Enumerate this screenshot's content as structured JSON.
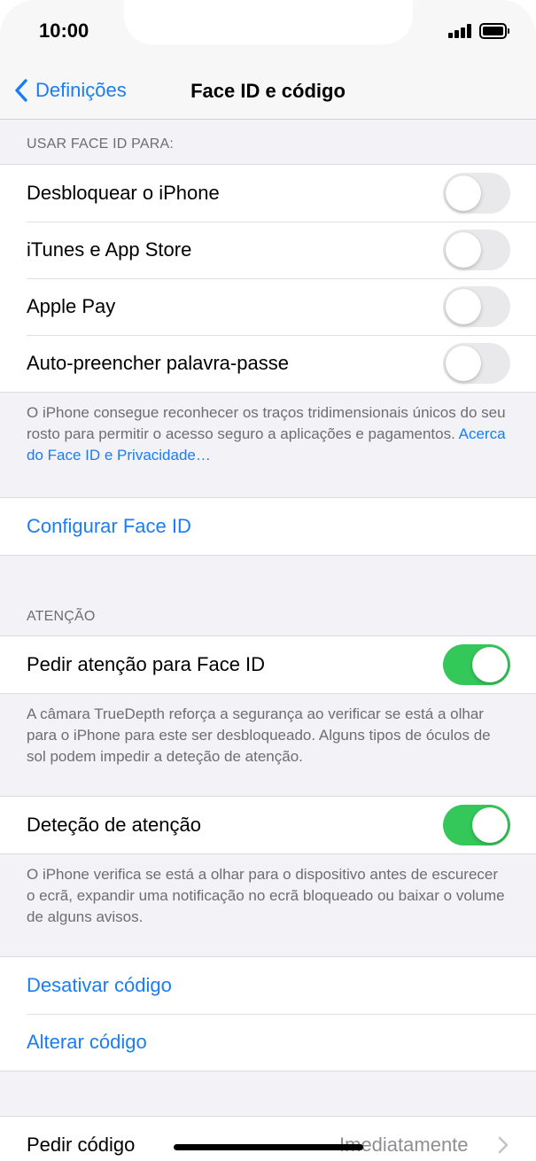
{
  "status_bar": {
    "time": "10:00"
  },
  "nav": {
    "back_label": "Definições",
    "title": "Face ID e código"
  },
  "face_id_section": {
    "header": "USAR FACE ID PARA:",
    "items": [
      {
        "label": "Desbloquear o iPhone",
        "enabled": false
      },
      {
        "label": "iTunes e App Store",
        "enabled": false
      },
      {
        "label": "Apple Pay",
        "enabled": false
      },
      {
        "label": "Auto-preencher palavra-passe",
        "enabled": false
      }
    ],
    "footer": "O iPhone consegue reconhecer os traços tridimensionais únicos do seu rosto para permitir o acesso seguro a aplicações e pagamentos.",
    "footer_link": "Acerca do Face ID e Privacidade…"
  },
  "setup": {
    "label": "Configurar Face ID"
  },
  "attention_section": {
    "header": "ATENÇÃO",
    "require_attention": {
      "label": "Pedir atenção para Face ID",
      "enabled": true
    },
    "require_attention_footer": "A câmara TrueDepth reforça a segurança ao verificar se está a olhar para o iPhone para este ser desbloqueado. Alguns tipos de óculos de sol podem impedir a deteção de atenção.",
    "attention_aware": {
      "label": "Deteção de atenção",
      "enabled": true
    },
    "attention_aware_footer": "O iPhone verifica se está a olhar para o dispositivo antes de escurecer o ecrã, expandir uma notificação no ecrã bloqueado ou baixar o volume de alguns avisos."
  },
  "passcode": {
    "turn_off": "Desativar código",
    "change": "Alterar código"
  },
  "require_passcode": {
    "label": "Pedir código",
    "value": "Imediatamente"
  },
  "colors": {
    "accent": "#1a7df5",
    "toggle_on": "#34c759",
    "toggle_off": "#e9e9eb",
    "background": "#f2f2f7"
  }
}
